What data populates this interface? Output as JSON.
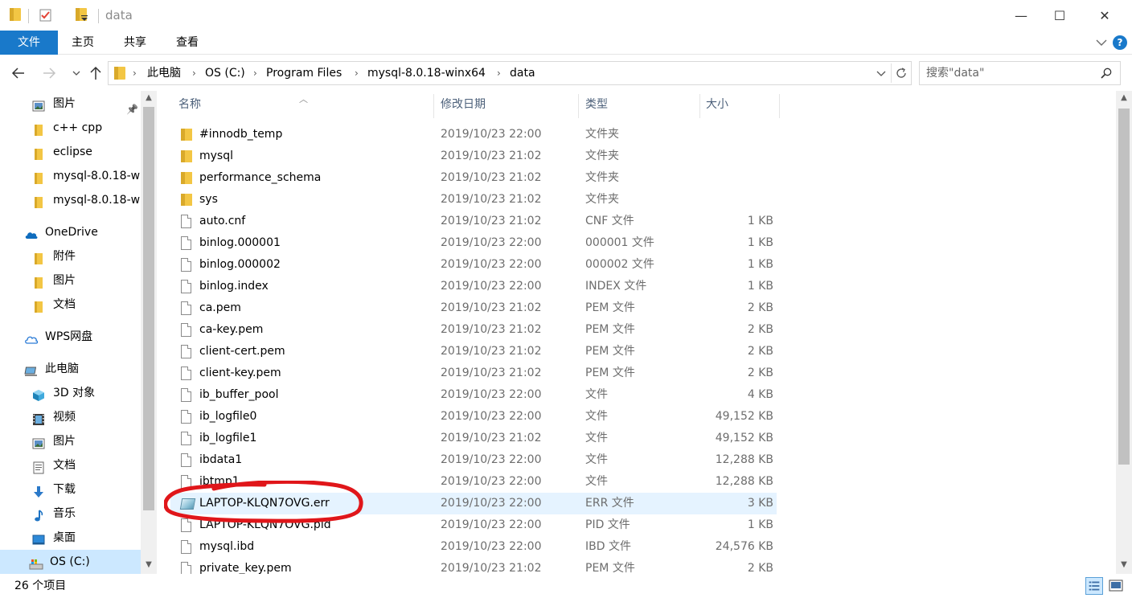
{
  "window": {
    "title": "data",
    "minimize_glyph": "—",
    "maximize_glyph": "☐",
    "close_glyph": "✕"
  },
  "ribbon": {
    "tabs": [
      "文件",
      "主页",
      "共享",
      "查看"
    ],
    "help_glyph": "?"
  },
  "address": {
    "crumbs": [
      "此电脑",
      "OS (C:)",
      "Program Files",
      "mysql-8.0.18-winx64",
      "data"
    ],
    "search_placeholder": "搜索\"data\""
  },
  "nav": {
    "items": [
      {
        "label": "图片",
        "icon": "pictures-icon",
        "pinned": true
      },
      {
        "label": "c++ cpp",
        "icon": "folder-icon"
      },
      {
        "label": "eclipse",
        "icon": "folder-icon"
      },
      {
        "label": "mysql-8.0.18-w",
        "icon": "folder-icon"
      },
      {
        "label": "mysql-8.0.18-w",
        "icon": "folder-icon"
      },
      {
        "label": "OneDrive",
        "icon": "onedrive-icon"
      },
      {
        "label": "附件",
        "icon": "folder-icon"
      },
      {
        "label": "图片",
        "icon": "folder-icon"
      },
      {
        "label": "文档",
        "icon": "folder-icon"
      },
      {
        "label": "WPS网盘",
        "icon": "cloud-icon"
      },
      {
        "label": "此电脑",
        "icon": "computer-icon"
      },
      {
        "label": "3D 对象",
        "icon": "3d-objects-icon"
      },
      {
        "label": "视频",
        "icon": "videos-icon"
      },
      {
        "label": "图片",
        "icon": "pictures-icon"
      },
      {
        "label": "文档",
        "icon": "documents-icon"
      },
      {
        "label": "下载",
        "icon": "downloads-icon"
      },
      {
        "label": "音乐",
        "icon": "music-icon"
      },
      {
        "label": "桌面",
        "icon": "desktop-icon"
      },
      {
        "label": "OS (C:)",
        "icon": "drive-icon",
        "selected": true
      }
    ]
  },
  "filelist": {
    "columns": [
      "名称",
      "修改日期",
      "类型",
      "大小"
    ],
    "rows": [
      {
        "name": "#innodb_temp",
        "date": "2019/10/23 22:00",
        "type": "文件夹",
        "size": "",
        "icon": "folder-icon"
      },
      {
        "name": "mysql",
        "date": "2019/10/23 21:02",
        "type": "文件夹",
        "size": "",
        "icon": "folder-icon"
      },
      {
        "name": "performance_schema",
        "date": "2019/10/23 21:02",
        "type": "文件夹",
        "size": "",
        "icon": "folder-icon"
      },
      {
        "name": "sys",
        "date": "2019/10/23 21:02",
        "type": "文件夹",
        "size": "",
        "icon": "folder-icon"
      },
      {
        "name": "auto.cnf",
        "date": "2019/10/23 21:02",
        "type": "CNF 文件",
        "size": "1 KB",
        "icon": "file-icon"
      },
      {
        "name": "binlog.000001",
        "date": "2019/10/23 22:00",
        "type": "000001 文件",
        "size": "1 KB",
        "icon": "file-icon"
      },
      {
        "name": "binlog.000002",
        "date": "2019/10/23 22:00",
        "type": "000002 文件",
        "size": "1 KB",
        "icon": "file-icon"
      },
      {
        "name": "binlog.index",
        "date": "2019/10/23 22:00",
        "type": "INDEX 文件",
        "size": "1 KB",
        "icon": "file-icon"
      },
      {
        "name": "ca.pem",
        "date": "2019/10/23 21:02",
        "type": "PEM 文件",
        "size": "2 KB",
        "icon": "file-icon"
      },
      {
        "name": "ca-key.pem",
        "date": "2019/10/23 21:02",
        "type": "PEM 文件",
        "size": "2 KB",
        "icon": "file-icon"
      },
      {
        "name": "client-cert.pem",
        "date": "2019/10/23 21:02",
        "type": "PEM 文件",
        "size": "2 KB",
        "icon": "file-icon"
      },
      {
        "name": "client-key.pem",
        "date": "2019/10/23 21:02",
        "type": "PEM 文件",
        "size": "2 KB",
        "icon": "file-icon"
      },
      {
        "name": "ib_buffer_pool",
        "date": "2019/10/23 22:00",
        "type": "文件",
        "size": "4 KB",
        "icon": "file-icon"
      },
      {
        "name": "ib_logfile0",
        "date": "2019/10/23 22:00",
        "type": "文件",
        "size": "49,152 KB",
        "icon": "file-icon"
      },
      {
        "name": "ib_logfile1",
        "date": "2019/10/23 21:02",
        "type": "文件",
        "size": "49,152 KB",
        "icon": "file-icon"
      },
      {
        "name": "ibdata1",
        "date": "2019/10/23 22:00",
        "type": "文件",
        "size": "12,288 KB",
        "icon": "file-icon"
      },
      {
        "name": "ibtmp1",
        "date": "2019/10/23 22:00",
        "type": "文件",
        "size": "12,288 KB",
        "icon": "file-icon"
      },
      {
        "name": "LAPTOP-KLQN7OVG.err",
        "date": "2019/10/23 22:00",
        "type": "ERR 文件",
        "size": "3 KB",
        "icon": "err-file-icon",
        "selected": true
      },
      {
        "name": "LAPTOP-KLQN7OVG.pid",
        "date": "2019/10/23 22:00",
        "type": "PID 文件",
        "size": "1 KB",
        "icon": "file-icon"
      },
      {
        "name": "mysql.ibd",
        "date": "2019/10/23 22:00",
        "type": "IBD 文件",
        "size": "24,576 KB",
        "icon": "file-icon"
      },
      {
        "name": "private_key.pem",
        "date": "2019/10/23 21:02",
        "type": "PEM 文件",
        "size": "2 KB",
        "icon": "file-icon"
      }
    ]
  },
  "status": {
    "item_count": "26 个项目"
  },
  "colors": {
    "accent": "#1979ca",
    "selection": "#cce8ff",
    "hover_row": "#e5f3ff",
    "annotation": "#e0161a",
    "folder": "#f3c644"
  }
}
